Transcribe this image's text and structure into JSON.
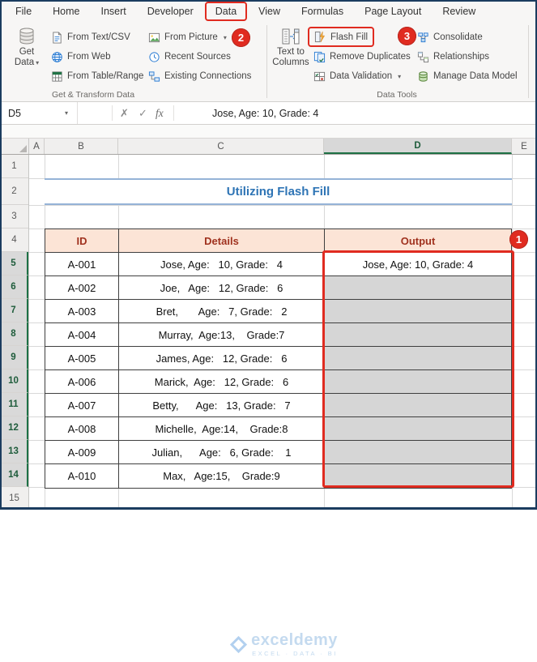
{
  "window": {
    "tabs": [
      "File",
      "Home",
      "Insert",
      "Developer",
      "Data",
      "View",
      "Formulas",
      "Page Layout",
      "Review"
    ],
    "active_tab": "Data"
  },
  "ribbon": {
    "get_data": {
      "line1": "Get",
      "line2": "Data"
    },
    "items": {
      "from_text_csv": "From Text/CSV",
      "from_web": "From Web",
      "from_table_range": "From Table/Range",
      "from_picture": "From Picture",
      "recent_sources": "Recent Sources",
      "existing_connections": "Existing Connections",
      "text_to_columns_1": "Text to",
      "text_to_columns_2": "Columns",
      "flash_fill": "Flash Fill",
      "remove_duplicates": "Remove Duplicates",
      "data_validation": "Data Validation",
      "consolidate": "Consolidate",
      "relationships": "Relationships",
      "manage_data_model": "Manage Data Model"
    },
    "group_labels": {
      "get_transform": "Get & Transform Data",
      "data_tools": "Data Tools"
    }
  },
  "formula_bar": {
    "name_box": "D5",
    "cancel": "✗",
    "enter": "✓",
    "fx": "fx",
    "value": "Jose, Age: 10, Grade: 4"
  },
  "annotations": {
    "step1": "1",
    "step2": "2",
    "step3": "3"
  },
  "sheet": {
    "col_headers": [
      "A",
      "B",
      "C",
      "D",
      "E"
    ],
    "row_headers": [
      "1",
      "2",
      "3",
      "4",
      "5",
      "6",
      "7",
      "8",
      "9",
      "10",
      "11",
      "12",
      "13",
      "14",
      "15"
    ],
    "title": "Utilizing Flash Fill",
    "active_cell": "D5",
    "table": {
      "headers": {
        "id": "ID",
        "details": "Details",
        "output": "Output"
      },
      "rows": [
        {
          "id": "A-001",
          "details": "Jose, Age:   10, Grade:   4",
          "output": "Jose, Age: 10, Grade: 4"
        },
        {
          "id": "A-002",
          "details": "Joe,   Age:   12, Grade:   6",
          "output": ""
        },
        {
          "id": "A-003",
          "details": "Bret,       Age:   7, Grade:   2",
          "output": ""
        },
        {
          "id": "A-004",
          "details": "Murray,  Age:13,    Grade:7",
          "output": ""
        },
        {
          "id": "A-005",
          "details": "James, Age:   12, Grade:   6",
          "output": ""
        },
        {
          "id": "A-006",
          "details": "Marick,  Age:   12, Grade:   6",
          "output": ""
        },
        {
          "id": "A-007",
          "details": "Betty,      Age:   13, Grade:   7",
          "output": ""
        },
        {
          "id": "A-008",
          "details": "Michelle,  Age:14,    Grade:8",
          "output": ""
        },
        {
          "id": "A-009",
          "details": "Julian,      Age:   6, Grade:    1",
          "output": ""
        },
        {
          "id": "A-010",
          "details": "Max,   Age:15,    Grade:9",
          "output": ""
        }
      ]
    }
  },
  "watermark": {
    "brand": "exceldemy",
    "tagline": "EXCEL · DATA · BI"
  },
  "colors": {
    "annotation_red": "#E02B20",
    "table_header_fill": "#FCE4D6",
    "table_header_text": "#A0321F",
    "title_blue": "#2E74B5",
    "title_rule_blue": "#95B3D7",
    "selection_gray": "#D6D6D6",
    "excel_green": "#1E7145"
  }
}
